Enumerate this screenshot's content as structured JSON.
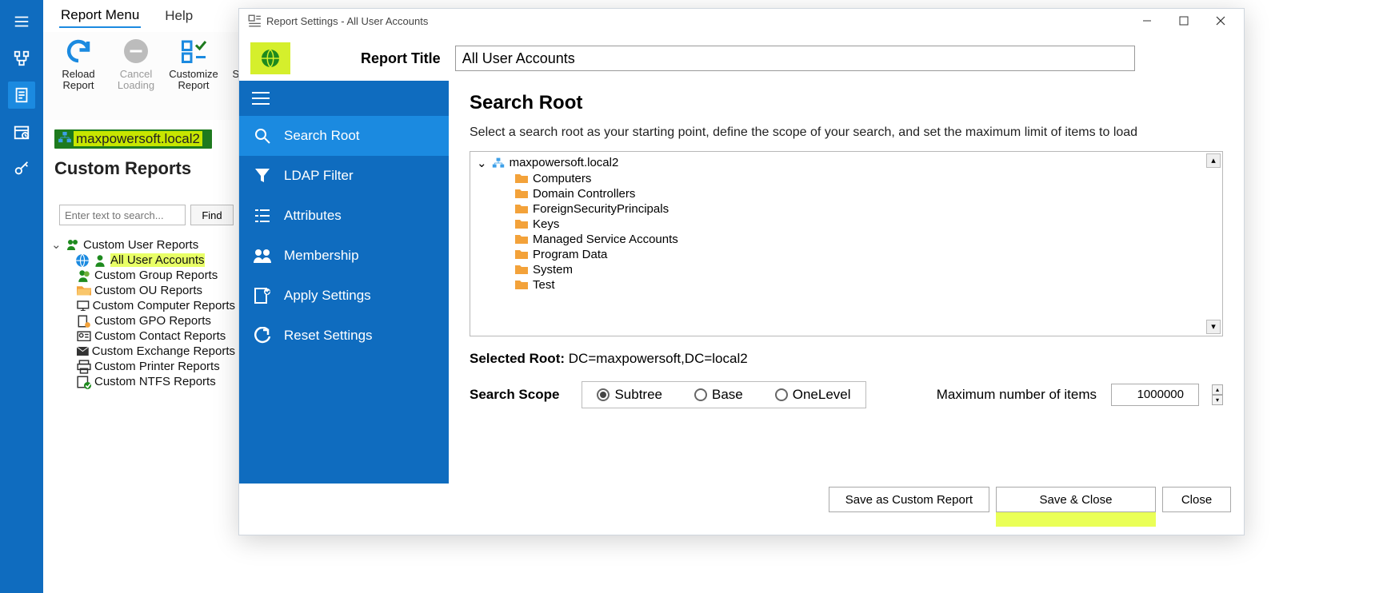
{
  "menu": {
    "report_menu": "Report Menu",
    "help": "Help"
  },
  "toolbar": {
    "reload": "Reload Report",
    "cancel": "Cancel Loading",
    "customize": "Customize Report",
    "save_as": "Save as New"
  },
  "domain": "maxpowersoft.local2",
  "custom_reports_heading": "Custom Reports",
  "search": {
    "placeholder": "Enter text to search...",
    "find": "Find"
  },
  "report_tree": {
    "parent": "Custom User Reports",
    "selected": "All User Accounts",
    "items": [
      "Custom Group Reports",
      "Custom OU Reports",
      "Custom Computer Reports",
      "Custom GPO Reports",
      "Custom Contact Reports",
      "Custom Exchange Reports",
      "Custom Printer Reports",
      "Custom NTFS Reports"
    ]
  },
  "dialog": {
    "title": "Report Settings - All User Accounts",
    "report_title_label": "Report Title",
    "report_title_value": "All User Accounts",
    "side": [
      "Search Root",
      "LDAP Filter",
      "Attributes",
      "Membership",
      "Apply Settings",
      "Reset Settings"
    ],
    "main": {
      "heading": "Search Root",
      "desc": "Select a search root as your starting point, define the scope of your search, and set the maximum limit of items to load",
      "root": "maxpowersoft.local2",
      "children": [
        "Computers",
        "Domain Controllers",
        "ForeignSecurityPrincipals",
        "Keys",
        "Managed Service Accounts",
        "Program Data",
        "System",
        "Test"
      ],
      "selected_root_label": "Selected Root:",
      "selected_root_value": "DC=maxpowersoft,DC=local2",
      "scope_label": "Search Scope",
      "scope_options": [
        "Subtree",
        "Base",
        "OneLevel"
      ],
      "max_label": "Maximum number of items",
      "max_value": "1000000"
    },
    "footer": {
      "save_custom": "Save as Custom Report",
      "save_close": "Save & Close",
      "close": "Close"
    }
  }
}
